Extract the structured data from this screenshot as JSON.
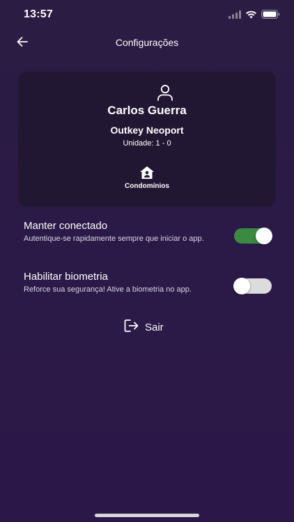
{
  "status_bar": {
    "time": "13:57",
    "icons": [
      "signal-icon",
      "wifi-icon",
      "battery-icon"
    ]
  },
  "header": {
    "title": "Configurações",
    "back_icon": "arrow-left-icon"
  },
  "profile": {
    "icon": "user-icon",
    "name": "Carlos Guerra",
    "company": "Outkey Neoport",
    "unit_label": "Unidade:",
    "unit_value": "1 - 0",
    "condo_icon": "home-user-icon",
    "condo_label": "Condomínios"
  },
  "settings": [
    {
      "title": "Manter conectado",
      "description": "Autentique-se rapidamente sempre que iniciar o app.",
      "enabled": true
    },
    {
      "title": "Habilitar biometria",
      "description": "Reforce sua segurança! Ative a biometria no app.",
      "enabled": false
    }
  ],
  "logout": {
    "icon": "logout-icon",
    "label": "Sair"
  },
  "colors": {
    "background": "#2b1a47",
    "card": "#221733",
    "toggle_on": "#3c8a42",
    "toggle_off": "#dcdcdc"
  }
}
